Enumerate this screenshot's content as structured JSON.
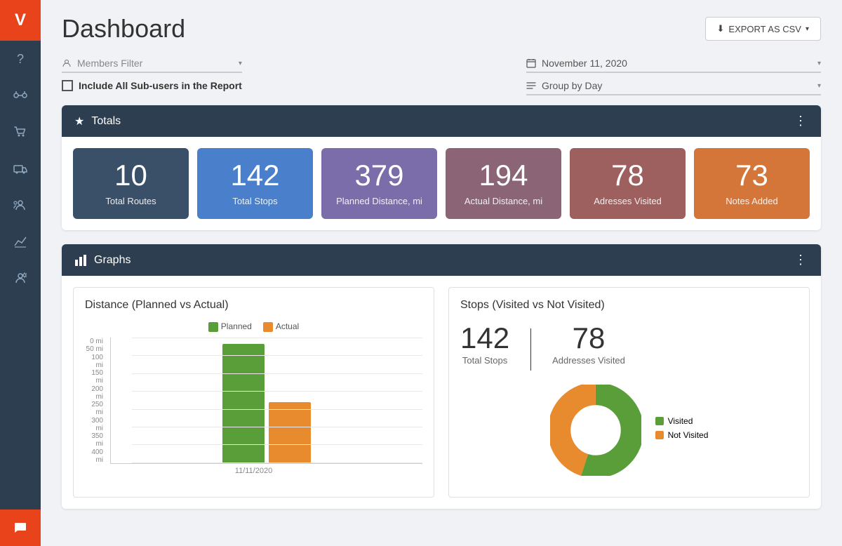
{
  "app": {
    "logo": "V",
    "page_title": "Dashboard"
  },
  "sidebar": {
    "icons": [
      {
        "name": "help-icon",
        "symbol": "?",
        "active": false
      },
      {
        "name": "routes-icon",
        "symbol": "⇌",
        "active": false
      },
      {
        "name": "cart-icon",
        "symbol": "🛒",
        "active": false
      },
      {
        "name": "truck-icon",
        "symbol": "🚛",
        "active": false
      },
      {
        "name": "group-icon",
        "symbol": "👥",
        "active": false
      },
      {
        "name": "chart-icon",
        "symbol": "📈",
        "active": false
      },
      {
        "name": "team-settings-icon",
        "symbol": "👤",
        "active": false
      }
    ],
    "chat_icon": "💬"
  },
  "header": {
    "export_label": "EXPORT AS CSV",
    "export_icon": "⬇"
  },
  "filters": {
    "members_filter_placeholder": "Members Filter",
    "date_value": "November 11, 2020",
    "date_icon": "📅",
    "group_by_label": "Group by Day",
    "group_by_icon": "≡",
    "include_subusers_label": "Include All Sub-users in the Report"
  },
  "totals": {
    "section_title": "Totals",
    "cards": [
      {
        "value": "10",
        "label": "Total Routes",
        "color_class": "card-blue-dark"
      },
      {
        "value": "142",
        "label": "Total Stops",
        "color_class": "card-blue-mid"
      },
      {
        "value": "379",
        "label": "Planned Distance, mi",
        "color_class": "card-purple"
      },
      {
        "value": "194",
        "label": "Actual Distance, mi",
        "color_class": "card-mauve"
      },
      {
        "value": "78",
        "label": "Adresses Visited",
        "color_class": "card-brown-red"
      },
      {
        "value": "73",
        "label": "Notes Added",
        "color_class": "card-orange"
      }
    ]
  },
  "graphs": {
    "section_title": "Graphs",
    "bar_chart": {
      "title": "Distance (Planned vs Actual)",
      "legend_planned": "Planned",
      "legend_actual": "Actual",
      "planned_color": "#5a9e3a",
      "actual_color": "#e88a2e",
      "y_labels": [
        "400 mi",
        "350 mi",
        "300 mi",
        "250 mi",
        "200 mi",
        "150 mi",
        "100 mi",
        "50 mi",
        "0 mi"
      ],
      "planned_value": 379,
      "actual_value": 194,
      "max_value": 400,
      "x_label": "11/11/2020"
    },
    "pie_chart": {
      "title": "Stops (Visited vs Not Visited)",
      "total_stops_value": "142",
      "total_stops_label": "Total Stops",
      "addresses_visited_value": "78",
      "addresses_visited_label": "Addresses Visited",
      "visited_color": "#5a9e3a",
      "not_visited_color": "#e88a2e",
      "visited_label": "Visited",
      "not_visited_label": "Not Visited",
      "visited_percent": 55,
      "not_visited_percent": 45
    }
  }
}
